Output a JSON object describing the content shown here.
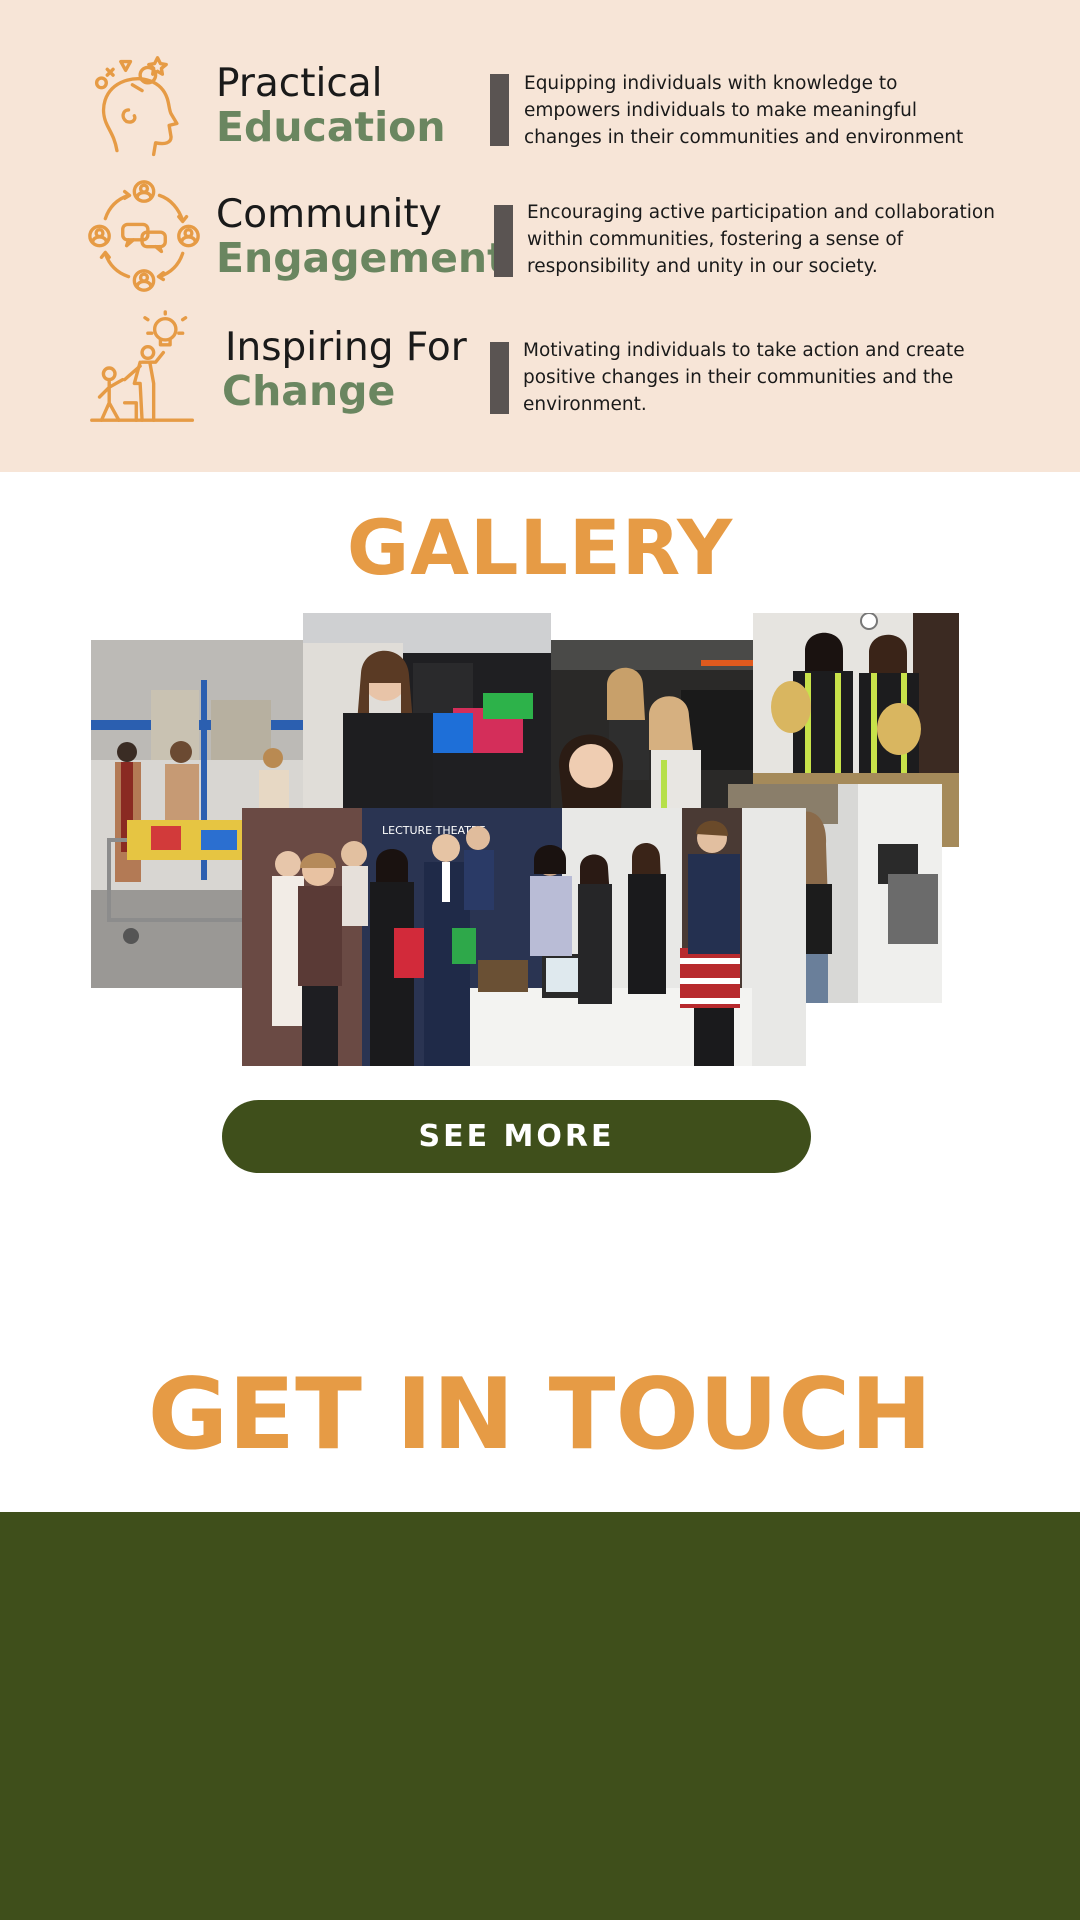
{
  "pillars": [
    {
      "icon": "head-ideas-icon",
      "title_line1": "Practical",
      "title_line2": "Education",
      "description": "Equipping individuals with knowledge to empowers individuals to make meaningful changes in their communities and environment"
    },
    {
      "icon": "community-network-icon",
      "title_line1": "Community",
      "title_line2": "Engagement",
      "description": "Encouraging active participation and collaboration within communities, fostering a sense of responsibility and unity in our society."
    },
    {
      "icon": "helping-hand-idea-icon",
      "title_line1": "Inspiring For",
      "title_line2": "Change",
      "description": "Motivating individuals to take action and create positive changes in their communities and the environment."
    }
  ],
  "gallery": {
    "title": "GALLERY",
    "photos": [
      {
        "name": "volunteers-with-grocery-cart-photo"
      },
      {
        "name": "volunteer-with-donation-bags-photo"
      },
      {
        "name": "volunteers-at-food-bank-photo"
      },
      {
        "name": "volunteers-with-potato-bags-photo"
      },
      {
        "name": "volunteer-in-warehouse-photo"
      },
      {
        "name": "lecture-theatre-group-photo",
        "sign_text": "LECTURE THEATRE"
      }
    ],
    "button_label": "SEE MORE"
  },
  "contact": {
    "title": "GET IN TOUCH"
  },
  "colors": {
    "accent_orange": "#e69b45",
    "sage_green": "#6a8660",
    "olive_green": "#3f4f1b",
    "peach_background": "#f7e5d7"
  }
}
